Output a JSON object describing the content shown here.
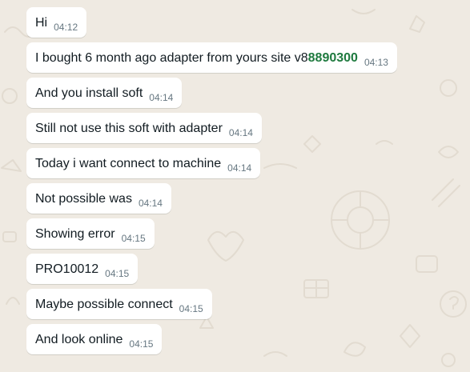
{
  "colors": {
    "background": "#efeae2",
    "bubble": "#ffffff",
    "text": "#111b21",
    "timestamp": "#667781",
    "highlight": "#1f7a3f"
  },
  "messages": [
    {
      "text": "Hi",
      "time": "04:12"
    },
    {
      "text": "I bought 6 month ago adapter from yours site v8",
      "highlight": "8890300",
      "time": "04:13"
    },
    {
      "text": "And you install soft",
      "time": "04:14"
    },
    {
      "text": "Still not use this soft with adapter",
      "time": "04:14"
    },
    {
      "text": "Today i want connect to machine",
      "time": "04:14"
    },
    {
      "text": "Not possible was",
      "time": "04:14"
    },
    {
      "text": "Showing error",
      "time": "04:15"
    },
    {
      "text": "PRO10012",
      "time": "04:15"
    },
    {
      "text": "Maybe possible connect",
      "time": "04:15"
    },
    {
      "text": "And look online",
      "time": "04:15"
    }
  ]
}
